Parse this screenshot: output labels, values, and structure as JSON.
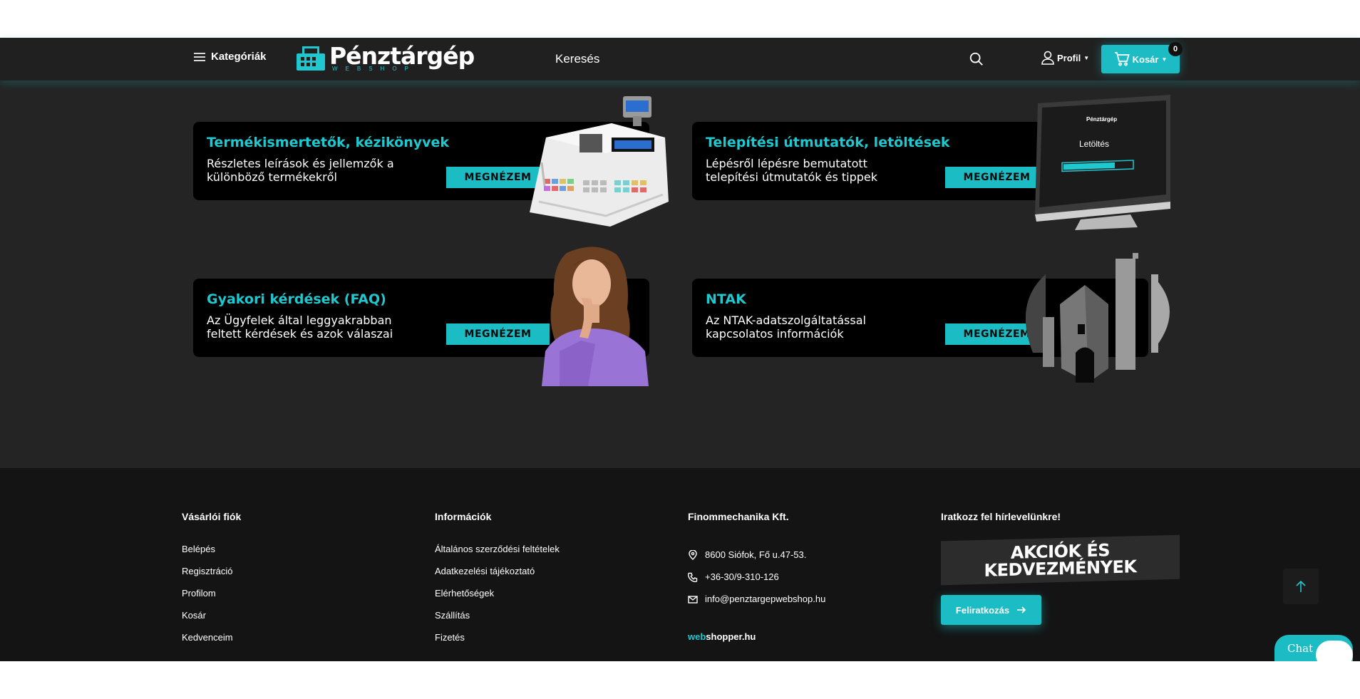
{
  "header": {
    "categories_label": "Kategóriák",
    "logo_title": "Pénztárgép",
    "logo_sub": "WEBSHOP",
    "search_label": "Keresés",
    "profile_label": "Profil",
    "cart_label": "Kosár",
    "cart_count": "0"
  },
  "cards": [
    {
      "title": "Termékismertetők, kézikönyvek",
      "desc": "Részletes leírások és jellemzők a különböző termékekről",
      "button": "MEGNÉZEM",
      "image": "cash-register"
    },
    {
      "title": "Telepítési útmutatók, letöltések",
      "desc": "Lépésről lépésre bemutatott telepítési útmutatók és tippek",
      "button": "MEGNÉZEM",
      "image": "monitor",
      "screen_logo": "Pénztárgép",
      "screen_text": "Letöltés"
    },
    {
      "title": "Gyakori kérdések (FAQ)",
      "desc": "Az Ügyfelek által leggyakrabban feltett kérdések és azok válaszai",
      "button": "MEGNÉZEM",
      "image": "thinking-woman"
    },
    {
      "title": "NTAK",
      "desc": "Az NTAK-adatszolgáltatással kapcsolatos információk",
      "button": "MEGNÉZEM",
      "image": "ntak-logo"
    }
  ],
  "footer": {
    "account": {
      "heading": "Vásárlói fiók",
      "links": [
        "Belépés",
        "Regisztráció",
        "Profilom",
        "Kosár",
        "Kedvenceim"
      ]
    },
    "info": {
      "heading": "Információk",
      "links": [
        "Általános szerződési feltételek",
        "Adatkezelési tájékoztató",
        "Elérhetőségek",
        "Szállítás",
        "Fizetés"
      ]
    },
    "company": {
      "heading": "Finommechanika Kft.",
      "address": "8600 Siófok, Fő u.47-53.",
      "phone": "+36-30/9-310-126",
      "email": "info@penztargepwebshop.hu",
      "webshopper_a": "web",
      "webshopper_b": "shopper.hu"
    },
    "newsletter": {
      "heading": "Iratkozz fel hírlevelünkre!",
      "promo_line1": "AKCIÓK ÉS",
      "promo_line2": "KEDVEZMÉNYEK",
      "button": "Feliratkozás"
    }
  },
  "chat_label": "Chat",
  "colors": {
    "accent": "#1cbcc5",
    "background": "#242424",
    "card": "#000000",
    "footer": "#141414"
  }
}
